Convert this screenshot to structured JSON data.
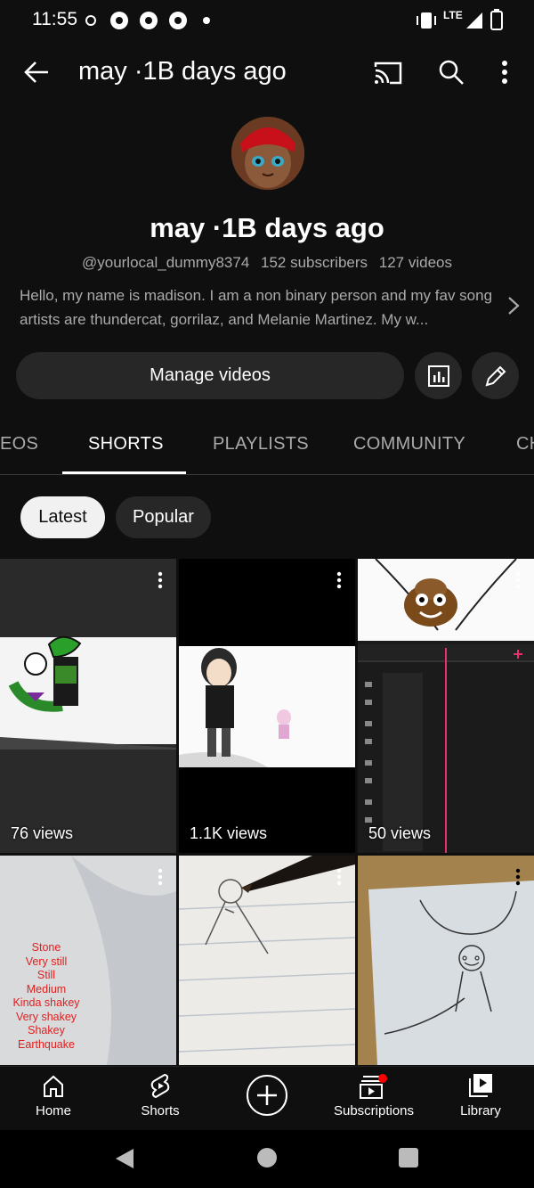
{
  "status_bar": {
    "time": "11:55",
    "network": "LTE"
  },
  "header": {
    "title": "may  ·1B days ago",
    "icons": [
      "back-arrow-icon",
      "cast-icon",
      "search-icon",
      "more-vert-icon"
    ]
  },
  "channel": {
    "name": "may  ·1B days ago",
    "handle": "@yourlocal_dummy8374",
    "subscribers": "152 subscribers",
    "videos": "127 videos",
    "description": "Hello, my name is madison. I am a non binary person and my fav song artists are thundercat, gorrilaz, and Melanie Martinez. My w..."
  },
  "actions": {
    "manage_label": "Manage videos",
    "icons": [
      "analytics-icon",
      "edit-pencil-icon"
    ]
  },
  "tabs": [
    {
      "label": "EOS"
    },
    {
      "label": "SHORTS",
      "active": true
    },
    {
      "label": "PLAYLISTS"
    },
    {
      "label": "COMMUNITY"
    },
    {
      "label": "CH"
    }
  ],
  "chips": [
    {
      "label": "Latest",
      "selected": true
    },
    {
      "label": "Popular",
      "selected": false
    }
  ],
  "shorts": [
    {
      "views": "76 views"
    },
    {
      "views": "1.1K views"
    },
    {
      "views": "50 views"
    },
    {
      "views": "",
      "overlay_text": [
        "Stone",
        "Very still",
        "Still",
        "Medium",
        "Kinda shakey",
        "Very shakey",
        "Shakey",
        "Earthquake"
      ]
    },
    {
      "views": ""
    },
    {
      "views": ""
    }
  ],
  "bottom_nav": [
    {
      "label": "Home",
      "icon": "home-icon"
    },
    {
      "label": "Shorts",
      "icon": "shorts-icon"
    },
    {
      "label": "",
      "icon": "create-plus-icon"
    },
    {
      "label": "Subscriptions",
      "icon": "subscriptions-icon"
    },
    {
      "label": "Library",
      "icon": "library-icon"
    }
  ],
  "colors": {
    "background": "#0f0f0f",
    "chip_bg": "#272727",
    "accent_red": "#ff0000",
    "overlay_text": "#e02020"
  }
}
